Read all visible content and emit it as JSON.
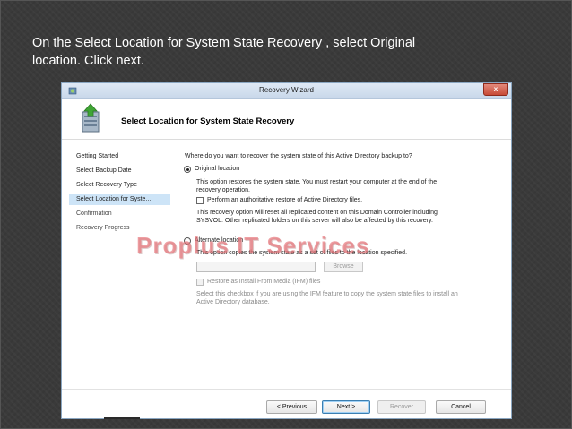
{
  "slide": {
    "caption_line1": "On the Select Location for System State Recovery , select Original",
    "caption_line2": "location. Click next."
  },
  "window": {
    "title": "Recovery Wizard",
    "close_label": "x"
  },
  "header": {
    "title": "Select Location for System State Recovery"
  },
  "nav": {
    "items": [
      {
        "label": "Getting Started"
      },
      {
        "label": "Select Backup Date"
      },
      {
        "label": "Select Recovery Type"
      },
      {
        "label": "Select Location for Syste..."
      },
      {
        "label": "Confirmation"
      },
      {
        "label": "Recovery Progress"
      }
    ]
  },
  "content": {
    "question": "Where do you want to recover the system state of this Active Directory backup to?",
    "original": {
      "label": "Original location",
      "desc_line1": "This option restores the system state. You must restart your computer at the end of the",
      "desc_line2": "recovery operation.",
      "authoritative_label": "Perform an authoritative restore of Active Directory files.",
      "warn_line1": "This recovery option will reset all replicated content on this Domain Controller including",
      "warn_line2": "SYSVOL. Other replicated folders on this server will also be affected by this recovery."
    },
    "alternate": {
      "label": "Alternate location",
      "desc": "This option copies the system state as a set of files to the location specified.",
      "browse_label": "Browse",
      "ifm_label": "Restore as Install From Media (IFM) files",
      "ifm_desc_line1": "Select this checkbox if you are using the IFM feature to copy the system state files to install an",
      "ifm_desc_line2": "Active Directory database."
    }
  },
  "buttons": {
    "previous": "< Previous",
    "next": "Next >",
    "recover": "Recover",
    "cancel": "Cancel"
  },
  "watermark": "Proplus IT Services"
}
